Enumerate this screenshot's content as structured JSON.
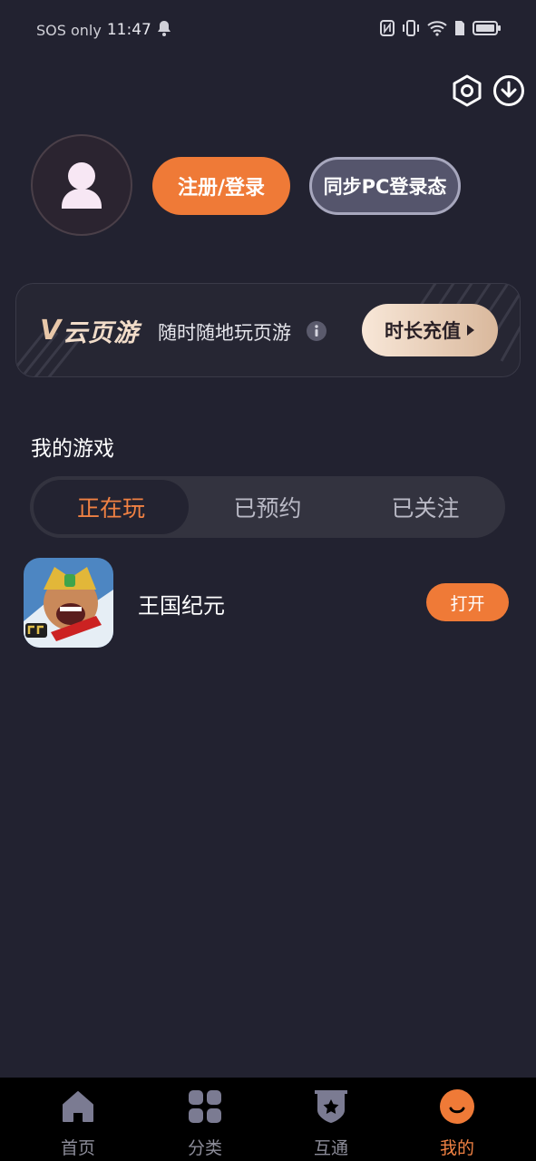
{
  "status_bar": {
    "carrier": "SOS only",
    "time": "11:47"
  },
  "top_actions": {
    "settings_icon": "settings-icon",
    "download_icon": "download-icon"
  },
  "profile": {
    "avatar_icon": "user-avatar-icon",
    "login_label": "注册/登录",
    "sync_label": "同步PC登录态"
  },
  "banner": {
    "brand_mark": "V",
    "brand_name": "云页游",
    "slogan": "随时随地玩页游",
    "recharge_label": "时长充值"
  },
  "my_games": {
    "title": "我的游戏",
    "tabs": [
      {
        "label": "正在玩",
        "active": true
      },
      {
        "label": "已预约",
        "active": false
      },
      {
        "label": "已关注",
        "active": false
      }
    ],
    "games": [
      {
        "name": "王国纪元",
        "action_label": "打开"
      }
    ]
  },
  "bottom_nav": {
    "items": [
      {
        "label": "首页",
        "icon": "home-icon",
        "active": false
      },
      {
        "label": "分类",
        "icon": "category-icon",
        "active": false
      },
      {
        "label": "互通",
        "icon": "badge-icon",
        "active": false
      },
      {
        "label": "我的",
        "icon": "profile-icon",
        "active": true
      }
    ]
  },
  "colors": {
    "background": "#222230",
    "accent": "#ef7a37",
    "tab_bar": "#33333f",
    "nav_bar": "#000000"
  }
}
